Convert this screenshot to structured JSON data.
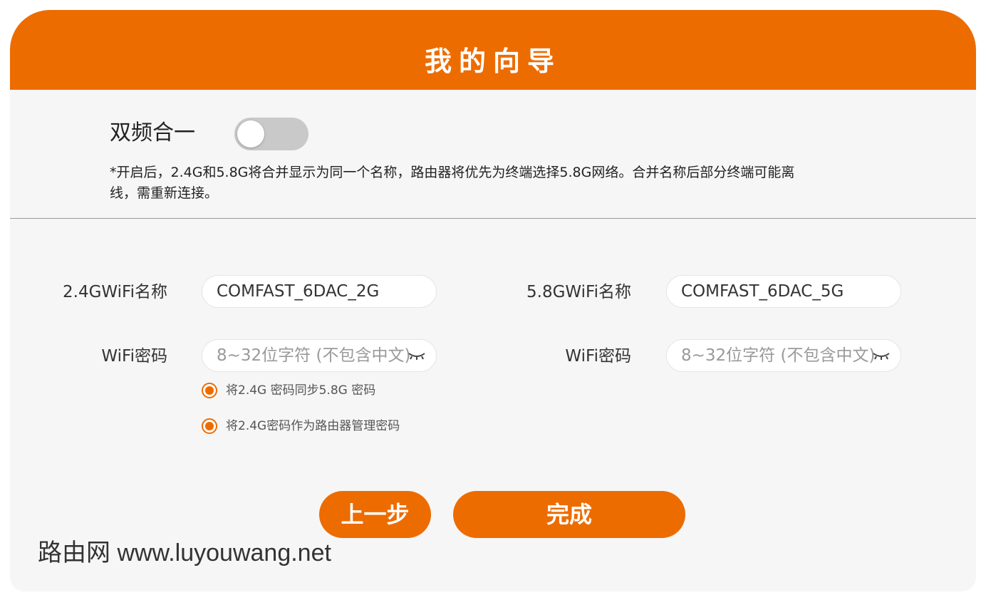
{
  "header": {
    "title": "我的向导"
  },
  "dual_band": {
    "label": "双频合一",
    "enabled": false,
    "notice": "*开启后，2.4G和5.8G将合并显示为同一个名称，路由器将优先为终端选择5.8G网络。合并名称后部分终端可能离线，需重新连接。"
  },
  "band_24": {
    "ssid_label": "2.4GWiFi名称",
    "ssid_value": "COMFAST_6DAC_2G",
    "password_label": "WiFi密码",
    "password_placeholder": "8~32位字符 (不包含中文)"
  },
  "band_58": {
    "ssid_label": "5.8GWiFi名称",
    "ssid_value": "COMFAST_6DAC_5G",
    "password_label": "WiFi密码",
    "password_placeholder": "8~32位字符 (不包含中文)"
  },
  "options": [
    {
      "label": "将2.4G 密码同步5.8G 密码",
      "selected": true
    },
    {
      "label": "将2.4G密码作为路由器管理密码",
      "selected": true
    }
  ],
  "buttons": {
    "back": "上一步",
    "finish": "完成"
  },
  "watermark": "路由网 www.luyouwang.net",
  "icons": {
    "password_toggle": "eye-closed-icon"
  },
  "colors": {
    "accent": "#ed6c00",
    "panel": "#f6f6f6",
    "toggle_off": "#c9c9c9"
  }
}
